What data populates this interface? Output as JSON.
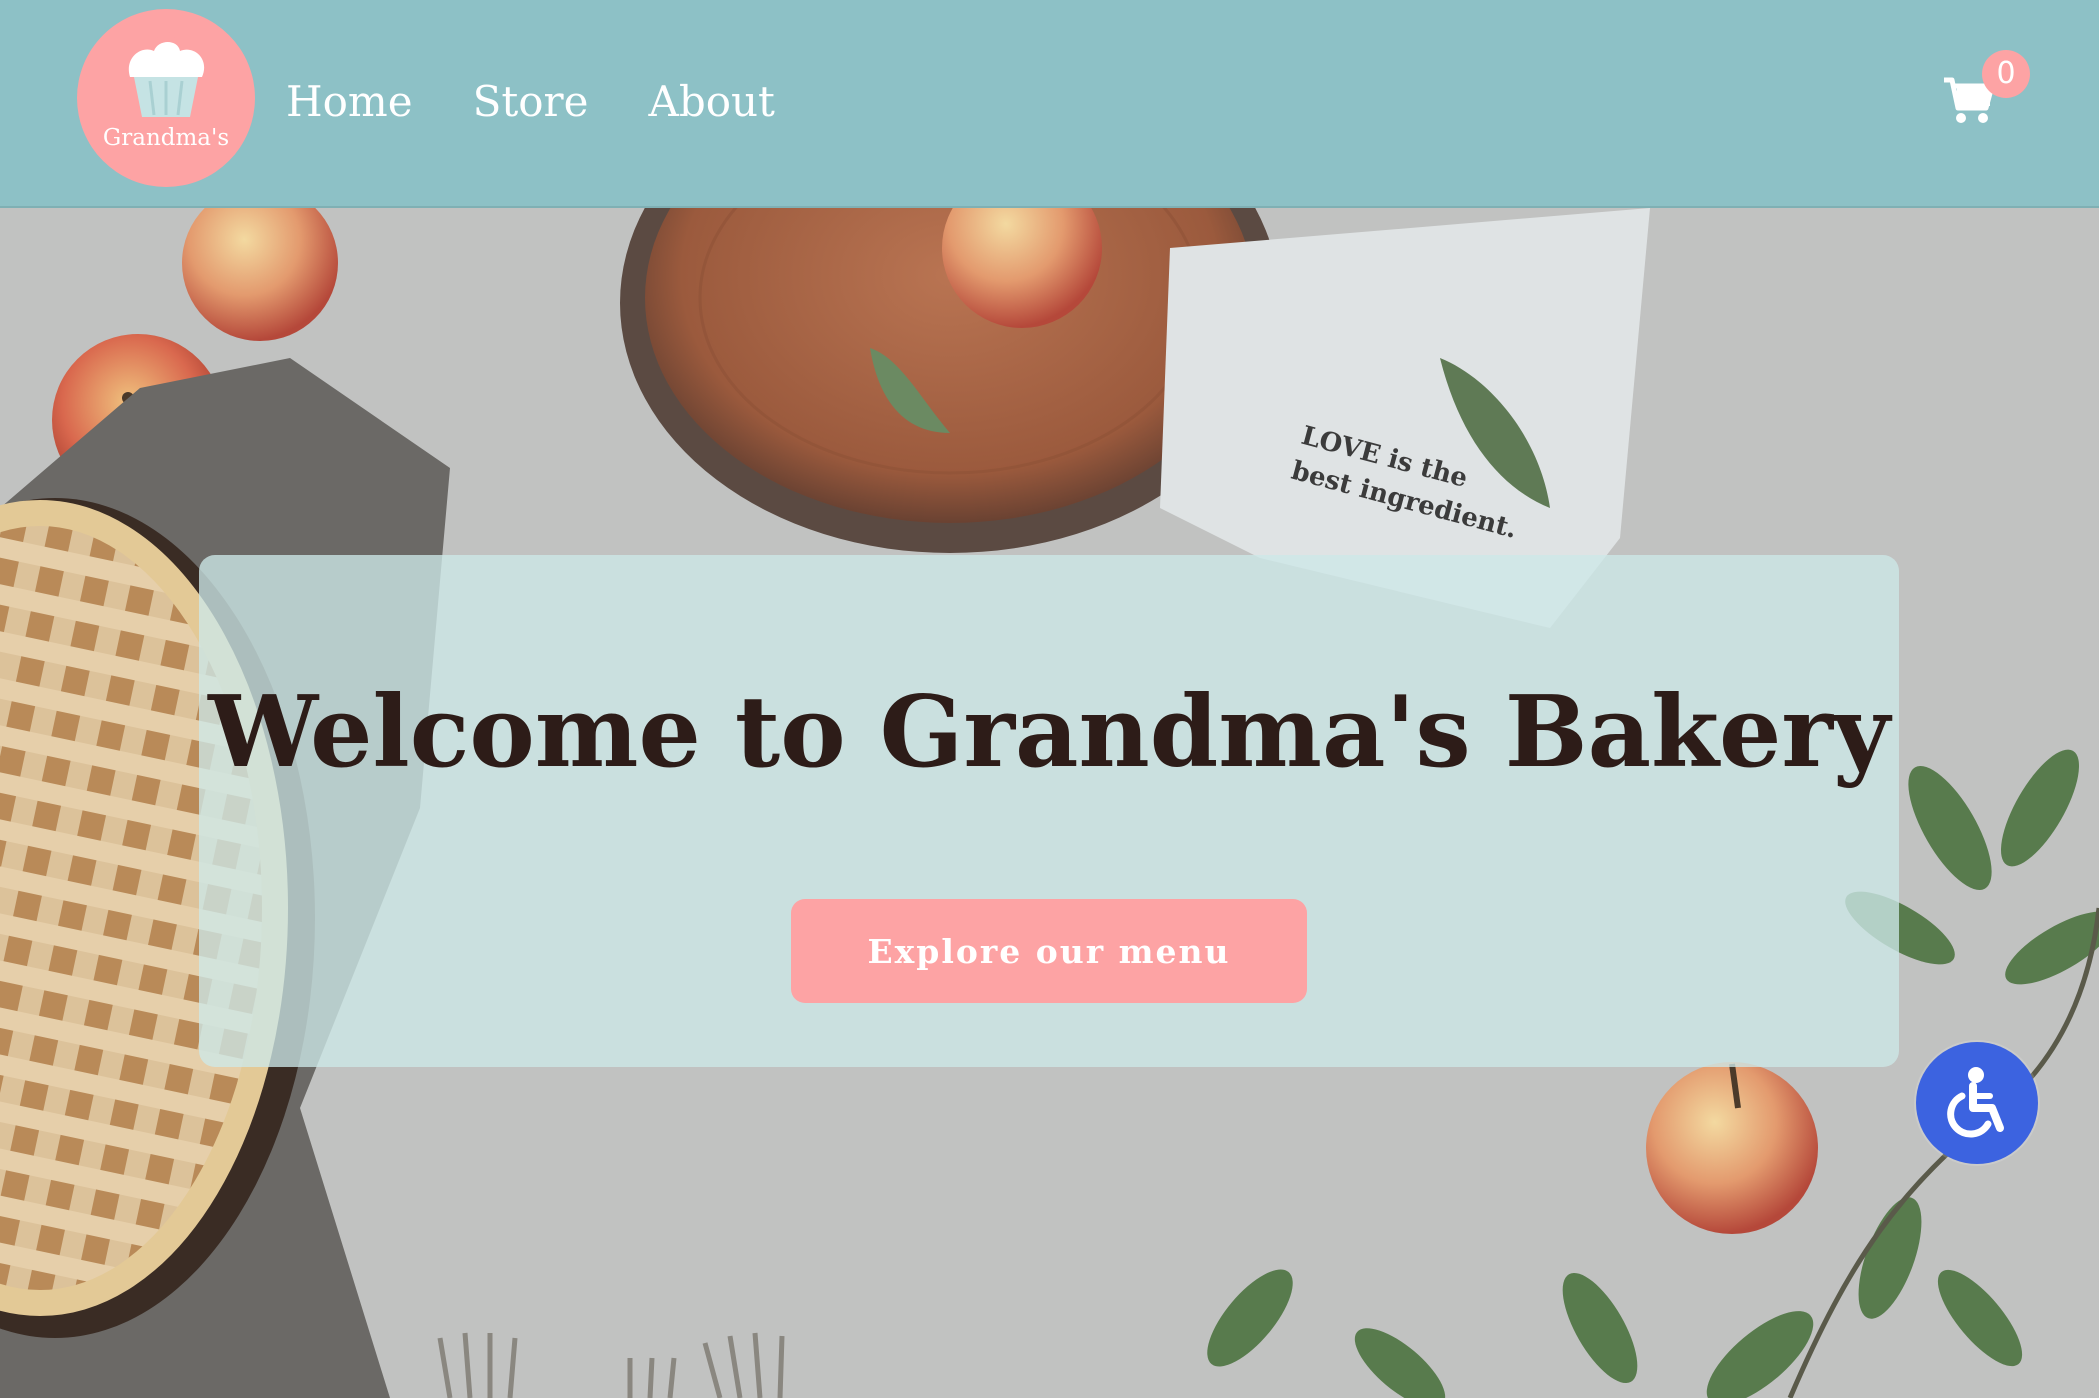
{
  "header": {
    "logo_text": "Grandma's",
    "nav": [
      {
        "label": "Home"
      },
      {
        "label": "Store"
      },
      {
        "label": "About"
      }
    ],
    "cart_count": "0"
  },
  "hero": {
    "title": "Welcome to Grandma's Bakery",
    "cta_label": "Explore our menu",
    "towel_text": [
      "LOVE is the",
      "best ingredient."
    ]
  },
  "colors": {
    "header_bg": "#8dc1c6",
    "accent_pink": "#fda3a4",
    "title_text": "#2d1c18",
    "accessibility_blue": "#3c63e0"
  },
  "icons": {
    "logo": "cupcake-icon",
    "cart": "shopping-cart-icon",
    "accessibility": "wheelchair-icon"
  }
}
